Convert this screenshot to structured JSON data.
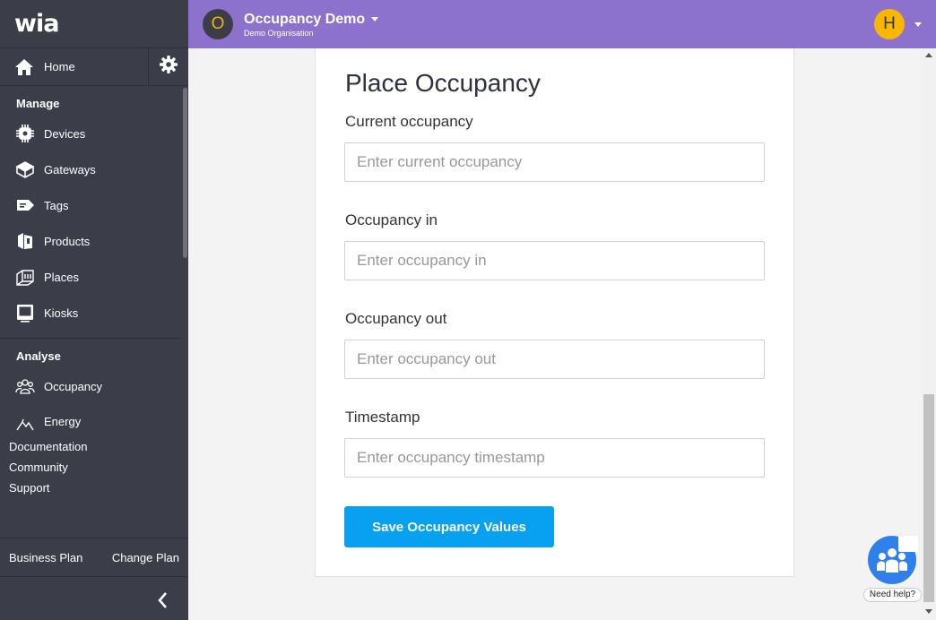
{
  "brand": {
    "logo_text": "wia"
  },
  "sidebar": {
    "home_label": "Home",
    "manage_title": "Manage",
    "manage_items": [
      {
        "label": "Devices",
        "icon": "devices-icon"
      },
      {
        "label": "Gateways",
        "icon": "gateways-icon"
      },
      {
        "label": "Tags",
        "icon": "tags-icon"
      },
      {
        "label": "Products",
        "icon": "products-icon"
      },
      {
        "label": "Places",
        "icon": "places-icon"
      },
      {
        "label": "Kiosks",
        "icon": "kiosks-icon"
      }
    ],
    "analyse_title": "Analyse",
    "analyse_items": [
      {
        "label": "Occupancy",
        "icon": "occupancy-icon"
      },
      {
        "label": "Energy",
        "icon": "energy-icon"
      }
    ],
    "links": [
      "Documentation",
      "Community",
      "Support"
    ],
    "plan_name": "Business Plan",
    "change_plan_label": "Change Plan"
  },
  "topbar": {
    "org_initial": "O",
    "org_name": "Occupancy Demo",
    "org_sub": "Demo Organisation",
    "user_initial": "H"
  },
  "form": {
    "title": "Place Occupancy",
    "fields": [
      {
        "label": "Current occupancy",
        "placeholder": "Enter current occupancy",
        "value": ""
      },
      {
        "label": "Occupancy in",
        "placeholder": "Enter occupancy in",
        "value": ""
      },
      {
        "label": "Occupancy out",
        "placeholder": "Enter occupancy out",
        "value": ""
      },
      {
        "label": "Timestamp",
        "placeholder": "Enter occupancy timestamp",
        "value": ""
      }
    ],
    "submit_label": "Save Occupancy Values"
  },
  "help": {
    "label": "Need help?"
  },
  "colors": {
    "sidebar_bg": "#3b3e48",
    "topbar_bg": "#8c72cc",
    "accent_button": "#08a0f0",
    "user_avatar": "#f9b700",
    "org_initial": "#f5b400"
  }
}
